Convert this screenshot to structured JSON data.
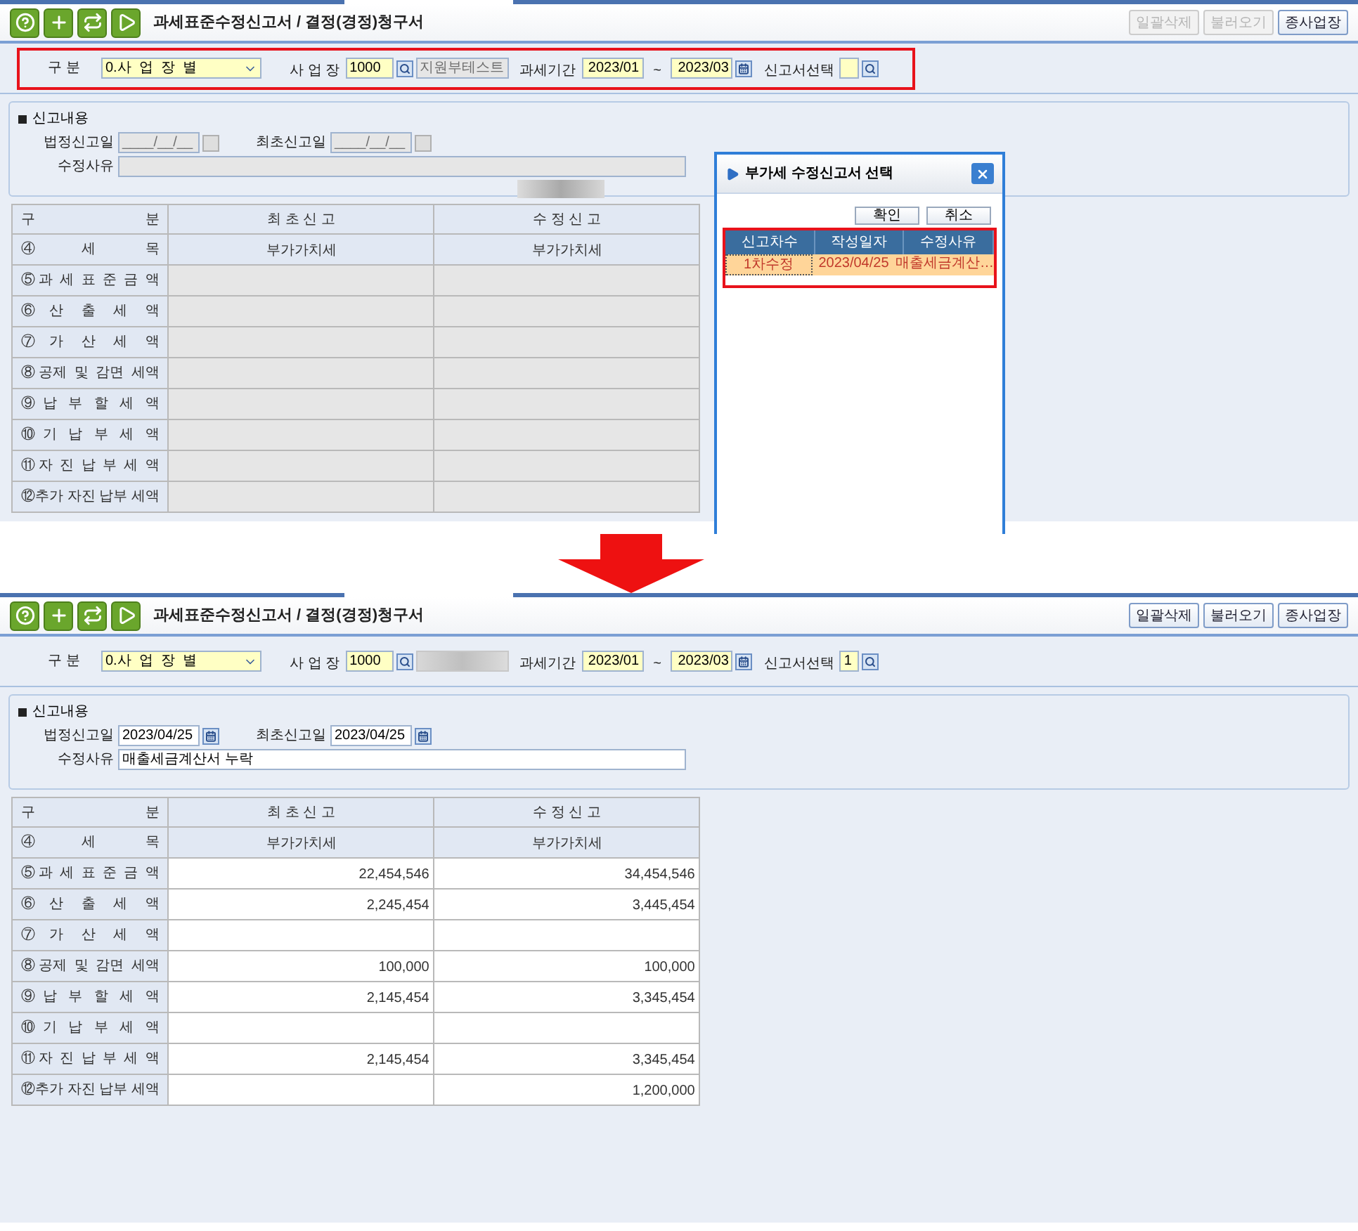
{
  "screens": [
    {
      "title": "과세표준수정신고서 / 결정(경정)청구서",
      "highlighted": true,
      "blurred_item": true,
      "actions": [
        {
          "label": "일괄삭제",
          "disabled": true
        },
        {
          "label": "불러오기",
          "disabled": true
        },
        {
          "label": "종사업장",
          "disabled": false
        }
      ],
      "filters": {
        "division_label": "구 분",
        "division_value": "0.사  업  장  별",
        "site_label": "사 업 장",
        "site_code": "1000",
        "site_name": "지원부테스트",
        "period_label": "과세기간",
        "period_from": "2023/01",
        "period_sep": "~",
        "period_to": "2023/03",
        "report_label": "신고서선택"
      },
      "content": {
        "heading": "신고내용",
        "disabled": true,
        "legal_date_label": "법정신고일",
        "legal_date": "____/__/__",
        "first_date_label": "최초신고일",
        "first_date": "____/__/__",
        "reason_label": "수정사유"
      },
      "table": {
        "disabled": true,
        "columns": [
          "구 분",
          "최 초 신 고",
          "수 정 신 고"
        ],
        "rows": [
          {
            "kind": "header",
            "label": "④세 목",
            "initial": "부가가치세",
            "revised": "부가가치세"
          },
          {
            "kind": "value",
            "label": "⑤과 세 표 준 금 액"
          },
          {
            "kind": "value",
            "label": "⑥산 출 세 액"
          },
          {
            "kind": "value",
            "label": "⑦가 산 세 액"
          },
          {
            "kind": "value",
            "label": "⑧공제 및 감면 세액"
          },
          {
            "kind": "value",
            "label": "⑨납 부 할 세 액"
          },
          {
            "kind": "value",
            "label": "⑩기 납 부 세 액"
          },
          {
            "kind": "value",
            "label": "⑪자 진 납 부 세 액"
          },
          {
            "kind": "value",
            "label": "⑫추가 자진 납부 세액"
          }
        ]
      },
      "popup": {
        "title": "부가세 수정신고서 선택",
        "buttons": [
          "확인",
          "취소"
        ],
        "highlighted": true,
        "columns": [
          "신고차수",
          "작성일자",
          "수정사유"
        ],
        "rows": [
          {
            "selected": true,
            "cells": [
              "1차수정",
              "2023/04/25",
              "매출세금계산…"
            ]
          }
        ]
      }
    },
    {
      "title": "과세표준수정신고서 / 결정(경정)청구서",
      "actions": [
        {
          "label": "일괄삭제",
          "disabled": false
        },
        {
          "label": "불러오기",
          "disabled": false
        },
        {
          "label": "종사업장",
          "disabled": false
        }
      ],
      "filters": {
        "division_label": "구 분",
        "division_value": "0.사  업  장  별",
        "site_label": "사 업 장",
        "site_code": "1000",
        "period_label": "과세기간",
        "period_from": "2023/01",
        "period_sep": "~",
        "period_to": "2023/03",
        "report_label": "신고서선택",
        "report_value": "1"
      },
      "content": {
        "heading": "신고내용",
        "disabled": false,
        "legal_date_label": "법정신고일",
        "legal_date": "2023/04/25",
        "first_date_label": "최초신고일",
        "first_date": "2023/04/25",
        "reason_label": "수정사유",
        "reason": "매출세금계산서 누락"
      },
      "table": {
        "disabled": false,
        "columns": [
          "구 분",
          "최 초 신 고",
          "수 정 신 고"
        ],
        "rows": [
          {
            "kind": "header",
            "label": "④세 목",
            "initial": "부가가치세",
            "revised": "부가가치세"
          },
          {
            "kind": "value",
            "label": "⑤과 세 표 준 금 액",
            "initial": "22,454,546",
            "revised": "34,454,546"
          },
          {
            "kind": "value",
            "label": "⑥산 출 세 액",
            "initial": "2,245,454",
            "revised": "3,445,454"
          },
          {
            "kind": "value",
            "label": "⑦가 산 세 액"
          },
          {
            "kind": "value",
            "label": "⑧공제 및 감면 세액",
            "initial": "100,000",
            "revised": "100,000"
          },
          {
            "kind": "value",
            "label": "⑨납 부 할 세 액",
            "initial": "2,145,454",
            "revised": "3,345,454"
          },
          {
            "kind": "value",
            "label": "⑩기 납 부 세 액"
          },
          {
            "kind": "value",
            "label": "⑪자 진 납 부 세 액",
            "initial": "2,145,454",
            "revised": "3,345,454"
          },
          {
            "kind": "value",
            "label": "⑫추가 자진 납부 세액",
            "revised": "1,200,000"
          }
        ]
      }
    }
  ]
}
